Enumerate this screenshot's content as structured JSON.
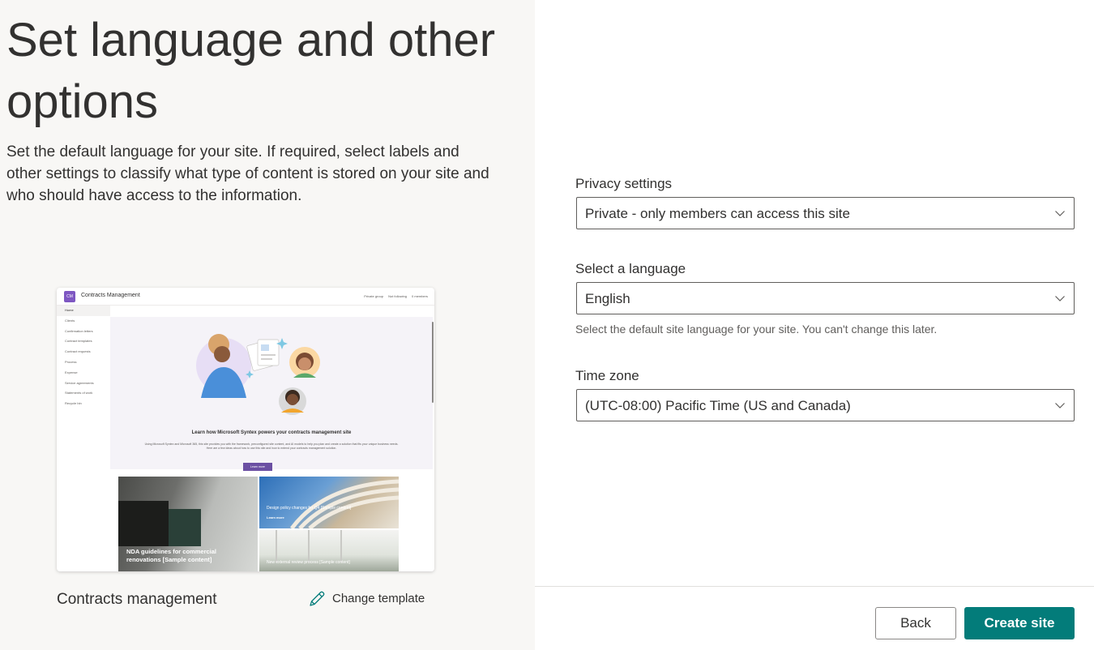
{
  "page": {
    "heading": "Set language and other options",
    "description": "Set the default language for your site. If required, select labels and other settings to classify what type of content is stored on your site and who should have access to the information."
  },
  "preview": {
    "logo_initials": "CM",
    "site_title": "Contracts Management",
    "meta": [
      "Private group",
      "Not following",
      "0 members"
    ],
    "nav_items": [
      "Home",
      "Clients",
      "Confirmation letters",
      "Contract templates",
      "Contract requests",
      "Process",
      "Expense",
      "Service agreements",
      "Statements of work",
      "Recycle bin"
    ],
    "hero_title": "Learn how Microsoft Syntex powers your contracts management site",
    "hero_text": "Using Microsoft Syntex and Microsoft 365, this site provides you with the framework, preconfigured site content, and AI models to help you plan and create a solution that fits your unique business needs. Here are a few ideas about how to use this site and how to extend your contracts management solution.",
    "learn_more": "Learn more",
    "tiles": [
      {
        "title": "NDA guidelines for commercial renovations [Sample content]"
      },
      {
        "title": "Design policy changes for Q4 [Sample content]",
        "link": "Learn more"
      },
      {
        "title": "New external review process [Sample content]"
      }
    ]
  },
  "template": {
    "name": "Contracts management",
    "change_label": "Change template"
  },
  "form": {
    "privacy": {
      "label": "Privacy settings",
      "value": "Private - only members can access this site"
    },
    "language": {
      "label": "Select a language",
      "value": "English",
      "help": "Select the default site language for your site. You can't change this later."
    },
    "timezone": {
      "label": "Time zone",
      "value": "(UTC-08:00) Pacific Time (US and Canada)"
    }
  },
  "actions": {
    "back": "Back",
    "create": "Create site"
  },
  "colors": {
    "accent": "#037c7a",
    "left_panel_bg": "#f8f7f5",
    "preview_brand": "#7e57c2"
  },
  "icons": [
    "pencil-icon",
    "chevron-down-icon"
  ]
}
